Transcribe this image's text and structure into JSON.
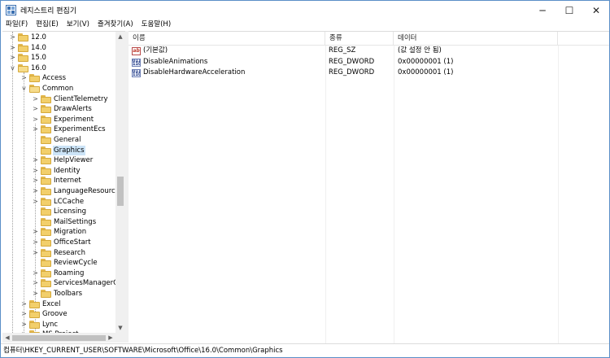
{
  "window": {
    "title": "레지스트리 편집기",
    "minimize": "─",
    "maximize": "☐",
    "close": "✕"
  },
  "menu": [
    "파일(F)",
    "편집(E)",
    "보기(V)",
    "즐겨찾기(A)",
    "도움말(H)"
  ],
  "tree": {
    "items": [
      {
        "label": "12.0",
        "level": 0,
        "expander": ">",
        "state": "collapsed"
      },
      {
        "label": "14.0",
        "level": 0,
        "expander": ">",
        "state": "collapsed"
      },
      {
        "label": "15.0",
        "level": 0,
        "expander": ">",
        "state": "collapsed"
      },
      {
        "label": "16.0",
        "level": 0,
        "expander": "v",
        "state": "expanded"
      },
      {
        "label": "Access",
        "level": 1,
        "expander": ">",
        "state": "collapsed"
      },
      {
        "label": "Common",
        "level": 1,
        "expander": "v",
        "state": "expanded"
      },
      {
        "label": "ClientTelemetry",
        "level": 2,
        "expander": ">",
        "state": "collapsed"
      },
      {
        "label": "DrawAlerts",
        "level": 2,
        "expander": ">",
        "state": "collapsed"
      },
      {
        "label": "Experiment",
        "level": 2,
        "expander": ">",
        "state": "collapsed"
      },
      {
        "label": "ExperimentEcs",
        "level": 2,
        "expander": ">",
        "state": "collapsed"
      },
      {
        "label": "General",
        "level": 2,
        "expander": "",
        "state": "leaf"
      },
      {
        "label": "Graphics",
        "level": 2,
        "expander": "",
        "state": "leaf",
        "selected": true
      },
      {
        "label": "HelpViewer",
        "level": 2,
        "expander": ">",
        "state": "collapsed"
      },
      {
        "label": "Identity",
        "level": 2,
        "expander": ">",
        "state": "collapsed"
      },
      {
        "label": "Internet",
        "level": 2,
        "expander": ">",
        "state": "collapsed"
      },
      {
        "label": "LanguageResources",
        "level": 2,
        "expander": ">",
        "state": "collapsed"
      },
      {
        "label": "LCCache",
        "level": 2,
        "expander": ">",
        "state": "collapsed"
      },
      {
        "label": "Licensing",
        "level": 2,
        "expander": "",
        "state": "leaf"
      },
      {
        "label": "MailSettings",
        "level": 2,
        "expander": "",
        "state": "leaf"
      },
      {
        "label": "Migration",
        "level": 2,
        "expander": ">",
        "state": "collapsed"
      },
      {
        "label": "OfficeStart",
        "level": 2,
        "expander": ">",
        "state": "collapsed"
      },
      {
        "label": "Research",
        "level": 2,
        "expander": ">",
        "state": "collapsed"
      },
      {
        "label": "ReviewCycle",
        "level": 2,
        "expander": "",
        "state": "leaf"
      },
      {
        "label": "Roaming",
        "level": 2,
        "expander": ">",
        "state": "collapsed"
      },
      {
        "label": "ServicesManagerCach",
        "level": 2,
        "expander": ">",
        "state": "collapsed"
      },
      {
        "label": "Toolbars",
        "level": 2,
        "expander": ">",
        "state": "collapsed"
      },
      {
        "label": "Excel",
        "level": 1,
        "expander": ">",
        "state": "collapsed"
      },
      {
        "label": "Groove",
        "level": 1,
        "expander": ">",
        "state": "collapsed"
      },
      {
        "label": "Lync",
        "level": 1,
        "expander": ">",
        "state": "collapsed"
      },
      {
        "label": "MS Project",
        "level": 1,
        "expander": ">",
        "state": "collapsed"
      }
    ]
  },
  "list": {
    "columns": [
      "이름",
      "종류",
      "데이터"
    ],
    "rows": [
      {
        "name": "(기본값)",
        "type": "REG_SZ",
        "data": "(값 설정 안 됨)",
        "icon": "string-value-icon",
        "icon_text": "ab"
      },
      {
        "name": "DisableAnimations",
        "type": "REG_DWORD",
        "data": "0x00000001 (1)",
        "icon": "dword-value-icon",
        "icon_text": "011 110"
      },
      {
        "name": "DisableHardwareAcceleration",
        "type": "REG_DWORD",
        "data": "0x00000001 (1)",
        "icon": "dword-value-icon",
        "icon_text": "011 110"
      }
    ]
  },
  "status": {
    "path": "컴퓨터\\HKEY_CURRENT_USER\\SOFTWARE\\Microsoft\\Office\\16.0\\Common\\Graphics"
  }
}
